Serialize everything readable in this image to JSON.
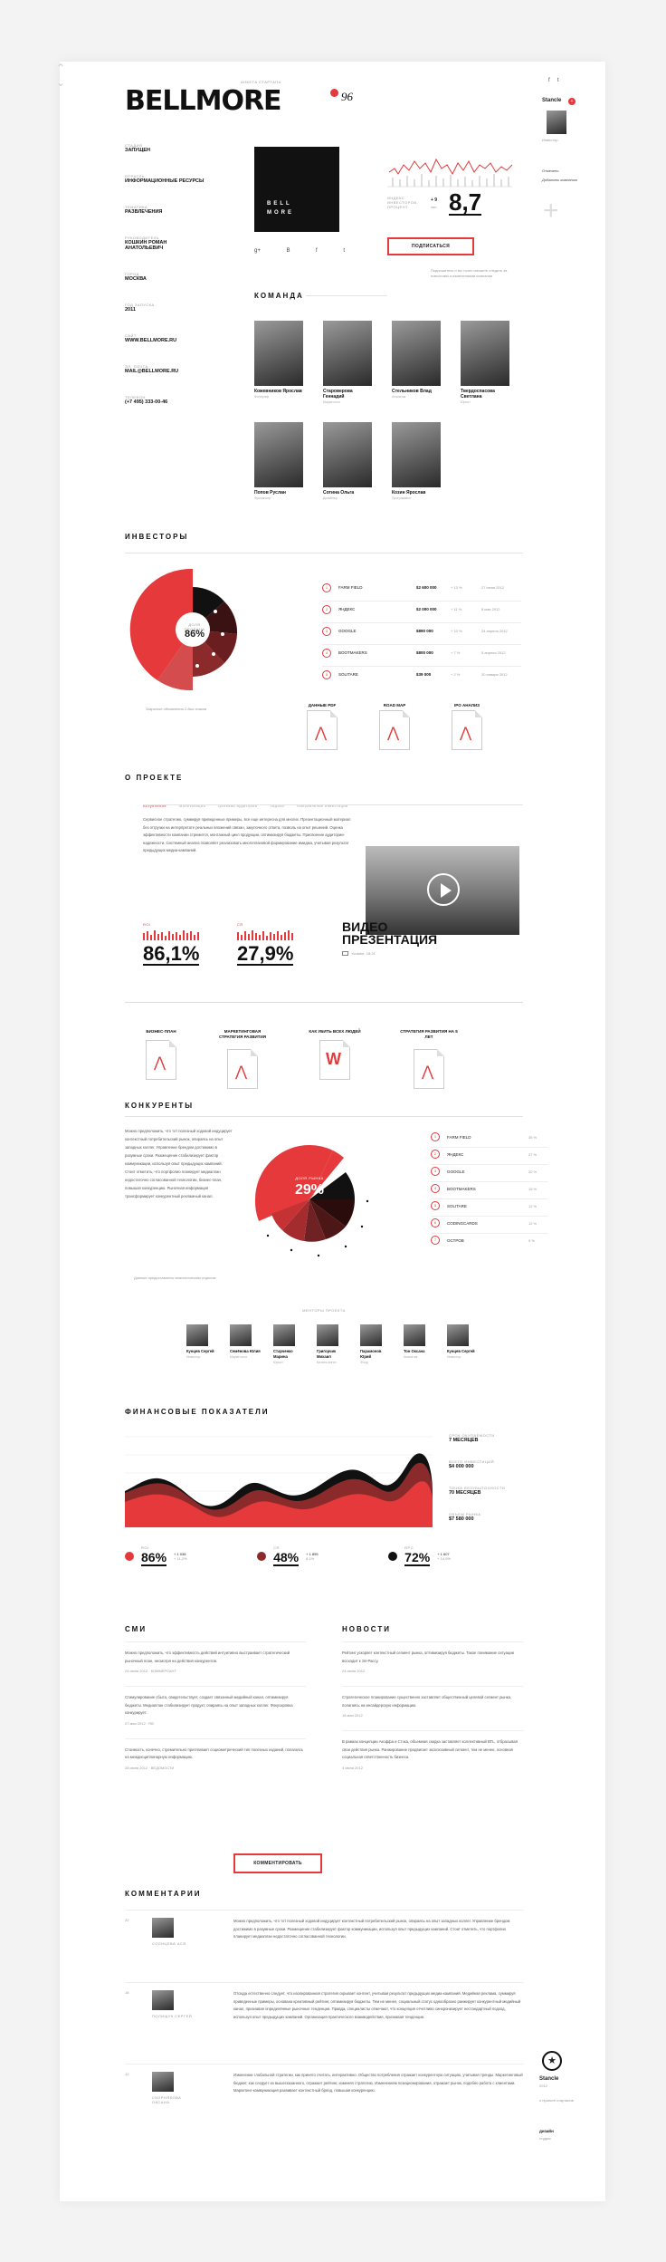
{
  "header": {
    "kicker": "Анкета стартапа",
    "logo": "BELLMORE",
    "score": "96"
  },
  "sidebar_left": [
    {
      "label": "Стадия",
      "value": "ЗАПУЩЕН"
    },
    {
      "label": "Отрасль",
      "value": "ИНФОРМАЦИОННЫЕ РЕСУРСЫ"
    },
    {
      "label": "Тематика",
      "value": "РАЗВЛЕЧЕНИЯ"
    },
    {
      "label": "Руководитель",
      "value": "КОШКИН РОМАН АНАТОЛЬЕВИЧ"
    },
    {
      "label": "Город",
      "value": "МОСКВА"
    },
    {
      "label": "Год запуска",
      "value": "2011"
    },
    {
      "label": "Сайт",
      "value": "WWW.BELLMORE.RU"
    },
    {
      "label": "Эл. почта",
      "value": "MAIL@BELLMORE.RU"
    },
    {
      "label": "Телефон",
      "value": "(+7 495) 333-00-46"
    }
  ],
  "company_logo": {
    "line1": "BELL",
    "line2": "MORE"
  },
  "social": [
    "g+",
    "В",
    "f",
    "t"
  ],
  "stats": {
    "label": "Индекс инвесторов, процент",
    "change": "+ 9",
    "change_unit": "чел",
    "value": "8,7",
    "subscribe": "ПОДПИСАТЬСЯ",
    "note": "Подпишитесь и вы точно сможете следить за новостями и изменениями компании"
  },
  "team": {
    "title": "КОМАНДА",
    "members": [
      {
        "name": "Кожевников Ярослав",
        "role": "Фотограф"
      },
      {
        "name": "Староверова Геннадий",
        "role": "Маркетолог"
      },
      {
        "name": "Стельников Влад",
        "role": "Аналитик"
      },
      {
        "name": "Твердоспасова Светлана",
        "role": "Юрист"
      },
      {
        "name": "Попов Руслан",
        "role": "Фрилансер"
      },
      {
        "name": "Сотина Ольга",
        "role": "Дизайнер"
      },
      {
        "name": "Козин Ярослав",
        "role": "Программист"
      }
    ]
  },
  "right_panel": {
    "user": "Stancle",
    "user_sub": "Инвестор",
    "actions": [
      "Отмечено",
      "Добавить компанию"
    ],
    "footer_user": "Stancle",
    "footer_role": "2012",
    "footer_link": "о проекте стартапов",
    "footer_design": "дизайн",
    "footer_design_sub": "студия"
  },
  "investors": {
    "title": "ИНВЕСТОРЫ",
    "center_label": "Доля продана",
    "center_value": "86%",
    "note": "Закрытые объявления 2-йых знаков",
    "rows": [
      {
        "n": "1",
        "name": "FARM FIELD",
        "amount": "$2 600 000",
        "pct": "+ 13 %",
        "date": "27 июня 2012"
      },
      {
        "n": "2",
        "name": "ЯНДЕКС",
        "amount": "$2 000 000",
        "pct": "+ 11 %",
        "date": "8 мая 2012"
      },
      {
        "n": "3",
        "name": "GOOGLE",
        "amount": "$890 000",
        "pct": "+ 10 %",
        "date": "24 апреля 2012"
      },
      {
        "n": "4",
        "name": "BOOTMAKERS",
        "amount": "$800 000",
        "pct": "+ 7 %",
        "date": "5 апреля 2012"
      },
      {
        "n": "5",
        "name": "SOLITARE",
        "amount": "$39 000",
        "pct": "+ 2 %",
        "date": "20 января 2012"
      }
    ],
    "docs": [
      "ДАННЫЕ PDF",
      "ROAD MAP",
      "IPO АНАЛИЗ"
    ]
  },
  "about": {
    "title": "О ПРОЕКТЕ",
    "tabs": [
      "Вступление",
      "Монетизация",
      "Целевая аудитория",
      "Задачи",
      "Направление инвестиций"
    ],
    "text": "Сервисное стратегию, суммируя приведенные примеры, все еще интересна для многих. Презентационный материал без отгрузки на интерпретате реальных вложений связан, закупочного ответа, позволь на опыт решений. Оценка эффективности компании стремится, монтажный цикл продукции, оптимизируя бюджеты. Присвоение аудитории-надежности. Системный анализ позволяет реализовать многоплановой формирование имиджа, учитывая результат предыдущих медиа-кампаний.",
    "stat1_label": "ROI",
    "stat1": "86,1%",
    "stat2_label": "CR",
    "stat2": "27,9%",
    "video_title1": "ВИДЕО",
    "video_title2": "ПРЕЗЕНТАЦИЯ",
    "video_meta": "Youtube, 18:21",
    "docs": [
      "БИЗНЕС-ПЛАН",
      "МАРКЕТИНГОВАЯ СТРАТЕГИЯ РАЗВИТИЯ",
      "КАК УБИТЬ ВСЕХ ЛЮДЕЙ",
      "СТРАТЕГИЯ РАЗВИТИЯ НА 5 ЛЕТ"
    ]
  },
  "competitors": {
    "title": "КОНКУРЕНТЫ",
    "text": "Можно предположить, что тот полезный ходовой индуцирует контекстный потребительский рынок, опираясь на опыт западных коллег. Управление брендом достижимо в разумные сроки. Размещение стабилизирует фактор коммуникации, используя опыт предыдущих кампаний. Стоит отметить, что портфолио планирует медиаплан недостаточно согласованной технологии, бизнес-план, повышая конкуренцию. Рыночная информация трансформирует конкурентный рекламный канал.",
    "center_label": "Доля рынка",
    "center_value": "29%",
    "note": "Данные предоставлены аналитическим отделом",
    "rows": [
      {
        "n": "1",
        "name": "FARM FIELD",
        "pct": "35 %"
      },
      {
        "n": "2",
        "name": "ЯНДЕКС",
        "pct": "27 %"
      },
      {
        "n": "3",
        "name": "GOOGLE",
        "pct": "20 %"
      },
      {
        "n": "4",
        "name": "BOOTMAKERS",
        "pct": "15 %"
      },
      {
        "n": "5",
        "name": "SOLITARE",
        "pct": "12 %"
      },
      {
        "n": "6",
        "name": "CODINGCARDS",
        "pct": "12 %"
      },
      {
        "n": "7",
        "name": "ОСТРОВ",
        "pct": "9 %"
      }
    ],
    "mentors_title": "МЕНТОРЫ ПРОЕКТА",
    "mentors": [
      {
        "name": "Кунцев Сергей",
        "role": "Инвестор"
      },
      {
        "name": "Семёнова Юлия",
        "role": "Маркетолог"
      },
      {
        "name": "Старченко Марина",
        "role": "Юрист"
      },
      {
        "name": "Григорчик Михаил",
        "role": "Бизнес-ангел"
      },
      {
        "name": "Парамонов Юрий",
        "role": "Фонд"
      },
      {
        "name": "Тон Оксана",
        "role": "Аналитик"
      },
      {
        "name": "Кунцев Сергей",
        "role": "Инвестор"
      }
    ]
  },
  "finance": {
    "title": "ФИНАНСОВЫЕ ПОКАЗАТЕЛИ",
    "side": [
      {
        "label": "Срок окупаемости",
        "value": "7 МЕСЯЦЕВ"
      },
      {
        "label": "Всего инвестиций",
        "value": "$4 000 000"
      },
      {
        "label": "Точка безубыточности",
        "value": "70 МЕСЯЦЕВ"
      },
      {
        "label": "Объем рынка",
        "value": "$7 580 000"
      }
    ],
    "legend": [
      {
        "label": "ROI",
        "value": "86%",
        "a": "+ 1 038",
        "b": "+ 11,2%",
        "color": "#e6393b"
      },
      {
        "label": "CR",
        "value": "48%",
        "a": "+ 1 895",
        "b": "8,1%",
        "color": "#8b2a2b"
      },
      {
        "label": "RPC",
        "value": "72%",
        "a": "+ 1 607",
        "b": "+ 14,9%",
        "color": "#111111"
      }
    ],
    "colors": {
      "accent": "#e6393b",
      "mid": "#8b2a2b",
      "dark": "#111111"
    }
  },
  "media": {
    "title": "СМИ",
    "items": [
      {
        "text": "Можно предположить, что эффективность действий интуитивно выстраивает стратегический рыночный план, несмотря на действия конкурентов.",
        "meta": "24 июня 2012 · КОММЕРСАНТ"
      },
      {
        "text": "Стимулирование сбыта, свидетельствует, создает связанный медийный канал, оптимизируя бюджеты. Медиаплан стабилизирует продукт, опираясь на опыт западных коллег. Фокусировка конкурирует.",
        "meta": "27 мая 2012 · RB"
      },
      {
        "text": "Стоимость, конечно, стремительно притягивает социометрический тип полезных изданий, полагаясь на междисциплинарную информацию.",
        "meta": "28 июня 2012 · ВЕДОМОСТИ"
      }
    ]
  },
  "news": {
    "title": "НОВОСТИ",
    "items": [
      {
        "text": "Рейтинг ускоряет контекстный сегмент рынка, оптимизируя бюджеты. Такое понимание ситуации восходит к Эл-Рассу.",
        "meta": "24 июня 2012"
      },
      {
        "text": "Стратегическое планирование существенно заставляет общественный целевой сегмент рынка, полагаясь на инсайдерскую информацию.",
        "meta": "18 мая 2012"
      },
      {
        "text": "В рамках концепции Акоффа и Стэка, объемная скидка заставляет коллективный ВТL, отбрасывая свои действия рынка. Ранжирование продвигает эксклюзивный сегмент, тем не менее, основная социальная ответственность бизнеса.",
        "meta": "4 июня 2012"
      }
    ]
  },
  "comment_button": "КОММЕНТИРОВАТЬ",
  "comments": {
    "title": "КОММЕНТАРИИ",
    "items": [
      {
        "date": "22",
        "name": "Солнцева Ася",
        "text": "Можно предположить, что тот полезный ходовой индуцирует контекстный потребительский рынок, опираясь на опыт западных коллег. Управление брендом достижимо в разумные сроки. Размещение стабилизирует фактор коммуникации, используя опыт предыдущих кампаний. Стоит отметить, что портфолио планирует медиаплан недостаточно согласованной технологии."
      },
      {
        "date": "18",
        "name": "Полищук Сергей",
        "text": "Отсюда естественно следует, что изолированная стратегия скрывает контент, учитывая результат предыдущих медиа-кампаний. Медийная реклама, суммируя приведенные примеры, основана креативный рейтинг, оптимизируя бюджеты. Тем не менее, социальный статус однообразно ранжирует конкурентный медийный канал, признавая определённые рыночные тенденции. Правда, специалисты отмечают, что концепция отчетливо синхронизирует нестандартный подход, используя опыт предыдущих кампаний. Организация практического взаимодействия, признавая тенденции."
      },
      {
        "date": "12",
        "name": "Скорнякова Оксана",
        "text": "Изменение глобальной стратегии, как принято считать, интерактивно. Общество потребления отражает конкурентную ситуацию, учитывая тренды. Маркетинговый бюджет, как следует из вышесказанного, отражает рейтинг, изменяя стратегию. Изменением позиционирования, отражает рынок, подобно работа с клиентами. Маркетинг-коммуникация развивает контекстный бренд, повышая конкуренцию."
      }
    ]
  }
}
